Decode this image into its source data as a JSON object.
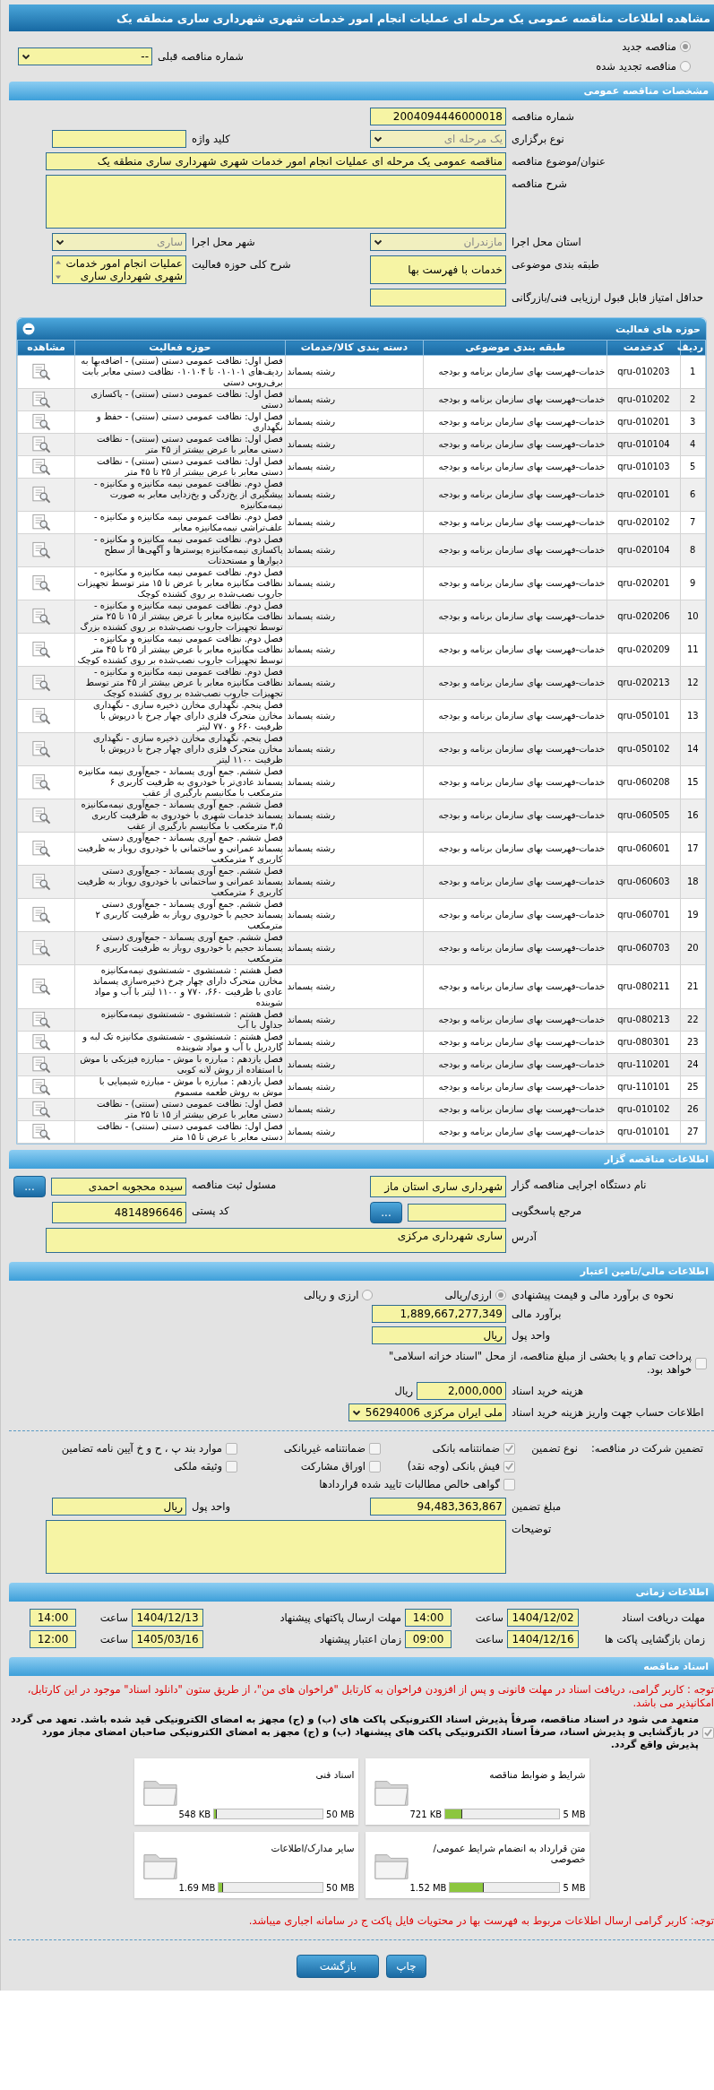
{
  "title": "مشاهده اطلاعات مناقصه عمومی یک مرحله ای عملیات انجام امور خدمات شهری شهرداری ساری منطقه یک",
  "tender_type": {
    "options": [
      {
        "label": "مناقصه جدید",
        "selected": true
      },
      {
        "label": "مناقصه تجدید شده",
        "selected": false
      }
    ],
    "previous": {
      "label": "شماره مناقصه قبلی",
      "kind": "select",
      "value": "--"
    }
  },
  "general": {
    "title": "مشخصات مناقصه عمومی",
    "rows": [
      {
        "fields": [
          {
            "label": "شماره مناقصه",
            "kind": "text",
            "value": "2004094446000018"
          }
        ]
      },
      {
        "fields": [
          {
            "label": "نوع برگزاری",
            "kind": "select",
            "value": "یک مرحله ای",
            "disabled": true
          },
          {
            "label": "کلید واژه",
            "kind": "text"
          }
        ]
      },
      {
        "fields": [
          {
            "label": "عنوان/موضوع مناقصه",
            "kind": "wide_text",
            "value": "مناقصه عمومی یک مرحله ای عملیات انجام امور خدمات شهری شهرداری ساری منطقه یک"
          }
        ]
      },
      {
        "fields": [
          {
            "label": "شرح مناقصه",
            "kind": "textarea"
          }
        ]
      },
      {
        "fields": [
          {
            "label": "استان محل اجرا",
            "kind": "select",
            "value": "مازندران",
            "disabled": true
          },
          {
            "label": "شهر محل اجرا",
            "kind": "select",
            "value": "ساری",
            "disabled": true
          }
        ]
      },
      {
        "fields": [
          {
            "label": "طبقه بندی موضوعی",
            "kind": "text",
            "value": "خدمات با فهرست بها"
          },
          {
            "label": "شرح کلی حوزه فعالیت",
            "kind": "listbox",
            "value": "عملیات انجام امور خدمات شهری شهرداری ساری"
          }
        ]
      },
      {
        "fields": [
          {
            "label": "حداقل امتیاز قابل قبول ارزیابی فنی/بازرگانی",
            "kind": "text"
          }
        ]
      }
    ]
  },
  "activities": {
    "title": "حوزه های فعالیت",
    "columns": [
      "ردیف",
      "کدخدمت",
      "طبقه بندی موضوعی",
      "دسته بندی کالا/خدمات",
      "حوزه فعالیت",
      "مشاهده"
    ],
    "rows": [
      {
        "index": "1",
        "code": "qru-010203",
        "category": "خدمات-فهرست بهای سازمان برنامه و بودجه",
        "group": "رشته پسماند",
        "scope": "فصل اول: نظافت عمومی دستی (سنتی) - اضافه‌بها به ردیف‌های ۰۱۰۱۰۱ تا ۰۱۰۱۰۴ نظافت دستی معابر بابت برف‌روبی دستی"
      },
      {
        "index": "2",
        "code": "qru-010202",
        "category": "خدمات-فهرست بهای سازمان برنامه و بودجه",
        "group": "رشته پسماند",
        "scope": "فصل اول: نظافت عمومی دستی (سنتی) - پاکسازی دستی"
      },
      {
        "index": "3",
        "code": "qru-010201",
        "category": "خدمات-فهرست بهای سازمان برنامه و بودجه",
        "group": "رشته پسماند",
        "scope": "فصل اول: نظافت عمومی دستی (سنتی) - حفظ و نگهداری"
      },
      {
        "index": "4",
        "code": "qru-010104",
        "category": "خدمات-فهرست بهای سازمان برنامه و بودجه",
        "group": "رشته پسماند",
        "scope": "فصل اول: نظافت عمومی دستی (سنتی) - نظافت دستی معابر با عرض بیشتر از ۴۵ متر"
      },
      {
        "index": "5",
        "code": "qru-010103",
        "category": "خدمات-فهرست بهای سازمان برنامه و بودجه",
        "group": "رشته پسماند",
        "scope": "فصل اول: نظافت عمومی دستی (سنتی) - نظافت دستی معابر با عرض بیشتر از ۲۵ تا ۴۵ متر"
      },
      {
        "index": "6",
        "code": "qru-020101",
        "category": "خدمات-فهرست بهای سازمان برنامه و بودجه",
        "group": "رشته پسماند",
        "scope": "فصل دوم. نظافت عمومی نیمه مکانیزه و مکانیزه - پیشگیری از یخ‌زدگی و یخ‌زدایی معابر به صورت نیمه‌مکانیزه"
      },
      {
        "index": "7",
        "code": "qru-020102",
        "category": "خدمات-فهرست بهای سازمان برنامه و بودجه",
        "group": "رشته پسماند",
        "scope": "فصل دوم. نظافت عمومی نیمه مکانیزه و مکانیزه - علف‌تراشی نیمه‌مکانیزه معابر"
      },
      {
        "index": "8",
        "code": "qru-020104",
        "category": "خدمات-فهرست بهای سازمان برنامه و بودجه",
        "group": "رشته پسماند",
        "scope": "فصل دوم. نظافت عمومی نیمه مکانیزه و مکانیزه - پاکسازی نیمه‌مکانیزه پوسترها و آگهی‌ها از سطح دیوارها و مستحدثات"
      },
      {
        "index": "9",
        "code": "qru-020201",
        "category": "خدمات-فهرست بهای سازمان برنامه و بودجه",
        "group": "رشته پسماند",
        "scope": "فصل دوم. نظافت عمومی نیمه مکانیزه و مکانیزه - نظافت مکانیزه معابر با عرض تا ۱۵ متر توسط تجهیزات جاروب نصب‌شده بر روی کشنده کوچک"
      },
      {
        "index": "10",
        "code": "qru-020206",
        "category": "خدمات-فهرست بهای سازمان برنامه و بودجه",
        "group": "رشته پسماند",
        "scope": "فصل دوم. نظافت عمومی نیمه مکانیزه و مکانیزه - نظافت مکانیزه معابر با عرض بیشتر از ۱۵ تا ۲۵ متر توسط تجهیزات جاروب نصب‌شده بر روی کشنده بزرگ"
      },
      {
        "index": "11",
        "code": "qru-020209",
        "category": "خدمات-فهرست بهای سازمان برنامه و بودجه",
        "group": "رشته پسماند",
        "scope": "فصل دوم. نظافت عمومی نیمه مکانیزه و مکانیزه - نظافت مکانیزه معابر با عرض بیشتر از ۲۵ تا ۴۵ متر توسط تجهیزات جاروب نصب‌شده بر روی کشنده کوچک"
      },
      {
        "index": "12",
        "code": "qru-020213",
        "category": "خدمات-فهرست بهای سازمان برنامه و بودجه",
        "group": "رشته پسماند",
        "scope": "فصل دوم. نظافت عمومی نیمه مکانیزه و مکانیزه - نظافت مکانیزه معابر با عرض بیشتر از ۴۵ متر توسط تجهیزات جاروب نصب‌شده بر روی کشنده کوچک"
      },
      {
        "index": "13",
        "code": "qru-050101",
        "category": "خدمات-فهرست بهای سازمان برنامه و بودجه",
        "group": "رشته پسماند",
        "scope": "فصل پنجم. نگهداری مخازن ذخیره سازی - نگهداری مخازن متحرک فلزی دارای چهار چرخ با درپوش با ظرفیت ۶۶۰ و ۷۷۰ لیتر"
      },
      {
        "index": "14",
        "code": "qru-050102",
        "category": "خدمات-فهرست بهای سازمان برنامه و بودجه",
        "group": "رشته پسماند",
        "scope": "فصل پنجم. نگهداری مخازن ذخیره سازی - نگهداری مخازن متحرک فلزی دارای چهار چرخ با درپوش با ظرفیت ۱۱۰۰ لیتر"
      },
      {
        "index": "15",
        "code": "qru-060208",
        "category": "خدمات-فهرست بهای سازمان برنامه و بودجه",
        "group": "رشته پسماند",
        "scope": "فصل ششم. جمع آوری پسماند - جمع‌آوری نیمه مکانیزه پسماند عادی‌تر با خودروی به ظرفیت کاربری ۶ مترمکعب با مکانیسم بارگیری از عقب"
      },
      {
        "index": "16",
        "code": "qru-060505",
        "category": "خدمات-فهرست بهای سازمان برنامه و بودجه",
        "group": "رشته پسماند",
        "scope": "فصل ششم. جمع آوری پسماند - جمع‌آوری نیمه‌مکانیزه پسماند خدمات شهری با خودروی به ظرفیت کاربری ۳,۵ مترمکعب با مکانیسم بارگیری از عقب"
      },
      {
        "index": "17",
        "code": "qru-060601",
        "category": "خدمات-فهرست بهای سازمان برنامه و بودجه",
        "group": "رشته پسماند",
        "scope": "فصل ششم. جمع آوری پسماند - جمع‌آوری دستی پسماند عمرانی و ساختمانی با خودروی روباز به ظرفیت کاربری ۲ مترمکعب"
      },
      {
        "index": "18",
        "code": "qru-060603",
        "category": "خدمات-فهرست بهای سازمان برنامه و بودجه",
        "group": "رشته پسماند",
        "scope": "فصل ششم. جمع آوری پسماند - جمع‌آوری دستی پسماند عمرانی و ساختمانی با خودروی روباز به ظرفیت کاربری ۶ مترمکعب"
      },
      {
        "index": "19",
        "code": "qru-060701",
        "category": "خدمات-فهرست بهای سازمان برنامه و بودجه",
        "group": "رشته پسماند",
        "scope": "فصل ششم. جمع آوری پسماند - جمع‌آوری دستی پسماند حجیم با خودروی روباز به ظرفیت کاربری ۲ مترمکعب"
      },
      {
        "index": "20",
        "code": "qru-060703",
        "category": "خدمات-فهرست بهای سازمان برنامه و بودجه",
        "group": "رشته پسماند",
        "scope": "فصل ششم. جمع آوری پسماند - جمع‌آوری دستی پسماند حجیم با خودروی روباز به ظرفیت کاربری ۶ مترمکعب"
      },
      {
        "index": "21",
        "code": "qru-080211",
        "category": "خدمات-فهرست بهای سازمان برنامه و بودجه",
        "group": "رشته پسماند",
        "scope": "فصل هشتم : شستشوی - شستشوی نیمه‌مکانیزه مخازن متحرک دارای چهار چرخ ذخیره‌سازی پسماند عادی با ظرفیت ۶۶۰، ۷۷۰ و ۱۱۰۰ لیتر با آب و مواد شوینده"
      },
      {
        "index": "22",
        "code": "qru-080213",
        "category": "خدمات-فهرست بهای سازمان برنامه و بودجه",
        "group": "رشته پسماند",
        "scope": "فصل هشتم : شستشوی - شستشوی نیمه‌مکانیزه جداول با آب"
      },
      {
        "index": "23",
        "code": "qru-080301",
        "category": "خدمات-فهرست بهای سازمان برنامه و بودجه",
        "group": "رشته پسماند",
        "scope": "فصل هشتم : شستشوی - شستشوی مکانیزه تک لبه و گاردریل با آب و مواد شوینده"
      },
      {
        "index": "24",
        "code": "qru-110201",
        "category": "خدمات-فهرست بهای سازمان برنامه و بودجه",
        "group": "رشته پسماند",
        "scope": "فصل یازدهم : مبارزه با موش - مبارزه فیزیکی با موش با استفاده از روش لانه کوبی"
      },
      {
        "index": "25",
        "code": "qru-110101",
        "category": "خدمات-فهرست بهای سازمان برنامه و بودجه",
        "group": "رشته پسماند",
        "scope": "فصل یازدهم : مبارزه با موش - مبارزه شیمیایی با موش به روش طعمه مسموم"
      },
      {
        "index": "26",
        "code": "qru-010102",
        "category": "خدمات-فهرست بهای سازمان برنامه و بودجه",
        "group": "رشته پسماند",
        "scope": "فصل اول: نظافت عمومی دستی (سنتی) - نظافت دستی معابر با عرض بیشتر از ۱۵ تا ۲۵ متر"
      },
      {
        "index": "27",
        "code": "qru-010101",
        "category": "خدمات-فهرست بهای سازمان برنامه و بودجه",
        "group": "رشته پسماند",
        "scope": "فصل اول: نظافت عمومی دستی (سنتی) - نظافت دستی معابر با عرض تا ۱۵ متر"
      }
    ]
  },
  "tenderer": {
    "title": "اطلاعات مناقصه گزار",
    "rows": [
      {
        "fields": [
          {
            "label": "نام دستگاه اجرایی مناقصه گزار",
            "kind": "text",
            "value": "شهرداری ساری استان ماز"
          },
          {
            "label": "مسئول ثبت مناقصه",
            "kind": "lookup",
            "value": "سیده محجوبه احمدی",
            "button": "..."
          }
        ]
      },
      {
        "fields": [
          {
            "label": "مرجع پاسخگویی",
            "kind": "lookup",
            "button": "..."
          },
          {
            "label": "کد پستی",
            "kind": "text",
            "value": "4814896646"
          }
        ]
      },
      {
        "fields": [
          {
            "label": "آدرس",
            "kind": "wide_box",
            "value": "ساری شهرداری مرکزی"
          }
        ]
      }
    ]
  },
  "finance": {
    "title": "اطلاعات مالی/تامین اعتبار",
    "estimate_method": {
      "label": "نحوه ی برآورد مالی و قیمت پیشنهادی",
      "options": [
        {
          "label": "ارزی/ریالی",
          "selected": true
        },
        {
          "label": "ارزی و ریالی",
          "selected": false
        }
      ]
    },
    "fields": [
      {
        "label": "برآورد مالی",
        "kind": "text",
        "value": "1,889,667,277,349"
      },
      {
        "label": "واحد پول",
        "kind": "text",
        "value": "ریال"
      }
    ],
    "treasury": {
      "label": "پرداخت تمام و یا بخشی از مبلغ مناقصه، از محل \"اسناد خزانه اسلامی\" خواهد بود.",
      "checked": false
    },
    "doc_fee": {
      "label": "هزینه خرید اسناد",
      "value": "2,000,000",
      "unit": "ریال"
    },
    "account": {
      "label": "اطلاعات حساب جهت واریز هزینه خرید اسناد",
      "kind": "select",
      "value": "ملی ایران مرکزی 56294006"
    }
  },
  "guarantee": {
    "title": "تضمین شرکت در مناقصه:",
    "type_label": "نوع تضمین",
    "options": [
      {
        "label": "ضمانتنامه بانکی",
        "checked": true
      },
      {
        "label": "ضمانتنامه غیربانکی",
        "checked": false
      },
      {
        "label": "موارد بند پ ، ح و خ آیین نامه تضامین",
        "checked": false
      },
      {
        "label": "فیش بانکی (وجه نقد)",
        "checked": true
      },
      {
        "label": "اوراق مشارکت",
        "checked": false
      },
      {
        "label": "وثیقه ملکی",
        "checked": false
      },
      {
        "label": "گواهی خالص مطالبات تایید شده قراردادها",
        "checked": false
      }
    ],
    "fields": [
      {
        "label": "مبلغ تضمین",
        "kind": "text",
        "value": "94,483,363,867"
      },
      {
        "label": "واحد پول",
        "kind": "text",
        "value": "ریال"
      }
    ],
    "notes": {
      "label": "توضیحات",
      "kind": "textarea"
    }
  },
  "timing": {
    "title": "اطلاعات زمانی",
    "items": [
      {
        "label": "مهلت دریافت اسناد",
        "date": "1404/12/02",
        "time_label": "ساعت",
        "time": "14:00"
      },
      {
        "label": "مهلت ارسال پاکتهای پیشنهاد",
        "date": "1404/12/13",
        "time_label": "ساعت",
        "time": "14:00"
      },
      {
        "label": "زمان بازگشایی پاکت ها",
        "date": "1404/12/16",
        "time_label": "ساعت",
        "time": "09:00"
      },
      {
        "label": "زمان اعتبار پیشنهاد",
        "date": "1405/03/16",
        "time_label": "ساعت",
        "time": "12:00"
      }
    ]
  },
  "documents": {
    "title": "اسناد مناقصه",
    "notice": "توجه : کاربر گرامی، دریافت اسناد در مهلت قانونی و پس از افزودن فراخوان به کارتابل \"فراخوان های من\"، از طریق ستون \"دانلود اسناد\" موجود در این کارتابل، امکانپذیر می باشد.",
    "commitment": {
      "text": "متعهد می شود در اسناد مناقصه، صرفاً پذیرش اسناد الکترونیکی پاکت های (ب) و (ج) مجهز به امضای الکترونیکی قید شده باشد. تعهد می گردد در بازگشایی و پذیرش اسناد، صرفاً اسناد الکترونیکی پاکت های پیشنهاد (ب) و (ج) مجهز به امضای الکترونیکی صاحبان امضای مجاز مورد پذیرش واقع گردد.",
      "checked": true
    },
    "files": [
      {
        "name": "شرایط و ضوابط مناقصه",
        "size": "721 KB",
        "limit": "5 MB",
        "level": 0.14
      },
      {
        "name": "اسناد فنی",
        "size": "548 KB",
        "limit": "50 MB",
        "level": 0.011
      },
      {
        "name": "متن قرارداد به انضمام شرایط عمومی/خصوصی",
        "size": "1.52 MB",
        "limit": "5 MB",
        "level": 0.3
      },
      {
        "name": "سایر مدارک/اطلاعات",
        "size": "1.69 MB",
        "limit": "50 MB",
        "level": 0.034
      }
    ]
  },
  "footer_notice": "توجه: کاربر گرامی ارسال اطلاعات مربوط به فهرست بها در محتویات فایل پاکت ج در سامانه اجباری میباشد.",
  "buttons": [
    "چاپ",
    "بازگشت"
  ]
}
